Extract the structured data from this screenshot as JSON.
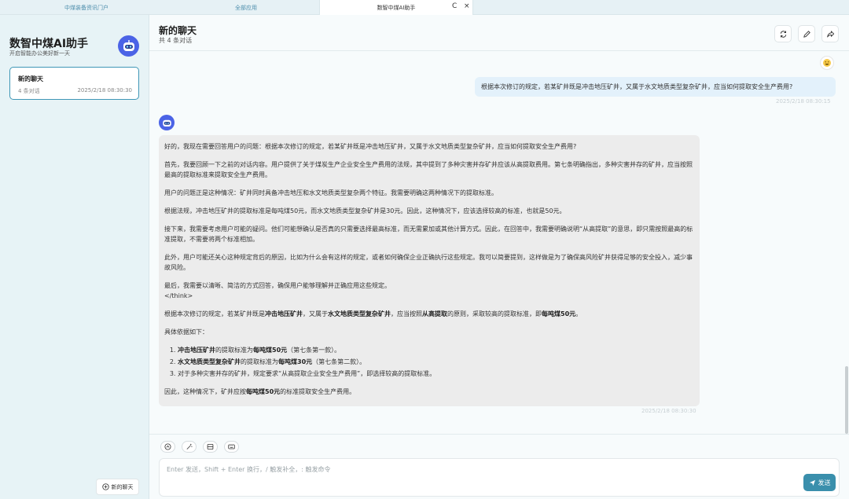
{
  "tabs": [
    {
      "label": "中煤装备资讯门户"
    },
    {
      "label": "全部应用"
    },
    {
      "label": "数智中煤AI助手"
    }
  ],
  "tab_controls": {
    "refresh": "C",
    "close": "×"
  },
  "sidebar": {
    "app_title": "数智中煤AI助手",
    "app_subtitle": "开启智能办公美好新一天",
    "conversation": {
      "title": "新的聊天",
      "count": "4 条对话",
      "time": "2025/2/18 08:30:30"
    },
    "new_chat_label": "新的聊天"
  },
  "header": {
    "title": "新的聊天",
    "subtitle": "共 4 条对话"
  },
  "user_message": {
    "text": "根据本次修订的规定，若某矿井既是冲击地压矿井，又属于水文地质类型复杂矿井，应当如何提取安全生产费用?",
    "time": "2025/2/18 08:30:15"
  },
  "bot_message": {
    "p1": "好的，我现在需要回答用户的问题：根据本次修订的规定，若某矿井既是冲击地压矿井，又属于水文地质类型复杂矿井，应当如何提取安全生产费用?",
    "p2": "首先，我要回顾一下之前的对话内容。用户提供了关于煤炭生产企业安全生产费用的法规，其中提到了多种灾害并存矿井应该从高提取费用。第七条明确指出，多种灾害并存的矿井，应当按照最高的提取标准来提取安全生产费用。",
    "p3": "用户的问题正是这种情况：矿井同时具备冲击地压和水文地质类型复杂两个特征。我需要明确这两种情况下的提取标准。",
    "p4": "根据法规，冲击地压矿井的提取标准是每吨煤50元，而水文地质类型复杂矿井是30元。因此，这种情况下，应该选择较高的标准，也就是50元。",
    "p5": "接下来，我需要考虑用户可能的疑问。他们可能想确认是否真的只需要选择最高标准，而无需累加或其他计算方式。因此，在回答中，我需要明确说明“从高提取”的意思，即只需按照最高的标准提取，不需要将两个标准相加。",
    "p6": "此外，用户可能还关心这种规定背后的原因，比如为什么会有这样的规定，或者如何确保企业正确执行这些规定。我可以简要提到，这样做是为了确保高风险矿井获得足够的安全投入，减少事故风险。",
    "p7a": "最后，我需要以清晰、简洁的方式回答，确保用户能够理解并正确应用这些规定。",
    "p7b": "</think>",
    "s1": {
      "a": "根据本次修订的规定，若某矿井既是",
      "b": "冲击地压矿井",
      "c": "，又属于",
      "d": "水文地质类型复杂矿井",
      "e": "，应当按照",
      "f": "从高提取",
      "g": "的原则，采取较高的提取标准，即",
      "h": "每吨煤50元",
      "i": "。"
    },
    "basis_intro": "具体依据如下：",
    "list": [
      {
        "a": "冲击地压矿井",
        "b": "的提取标准为",
        "c": "每吨煤50元",
        "d": "（第七条第一款）。"
      },
      {
        "a": "水文地质类型复杂矿井",
        "b": "的提取标准为",
        "c": "每吨煤30元",
        "d": "（第七条第二款）。"
      },
      {
        "text": "对于多种灾害并存的矿井，规定要求“从高提取企业安全生产费用”，即选择较高的提取标准。"
      }
    ],
    "conclusion": {
      "a": "因此，这种情况下，矿井应按",
      "b": "每吨煤50元",
      "c": "的标准提取安全生产费用。"
    },
    "time": "2025/2/18 08:30:30"
  },
  "input": {
    "placeholder": "Enter 发送，Shift + Enter 换行，/ 触发补全，: 触发命令",
    "send_label": "发送"
  },
  "colors": {
    "accent": "#3a8fac",
    "brand_logo": "#4b63e6",
    "user_bubble": "#e3f1fb",
    "bot_bubble": "#ececec"
  }
}
